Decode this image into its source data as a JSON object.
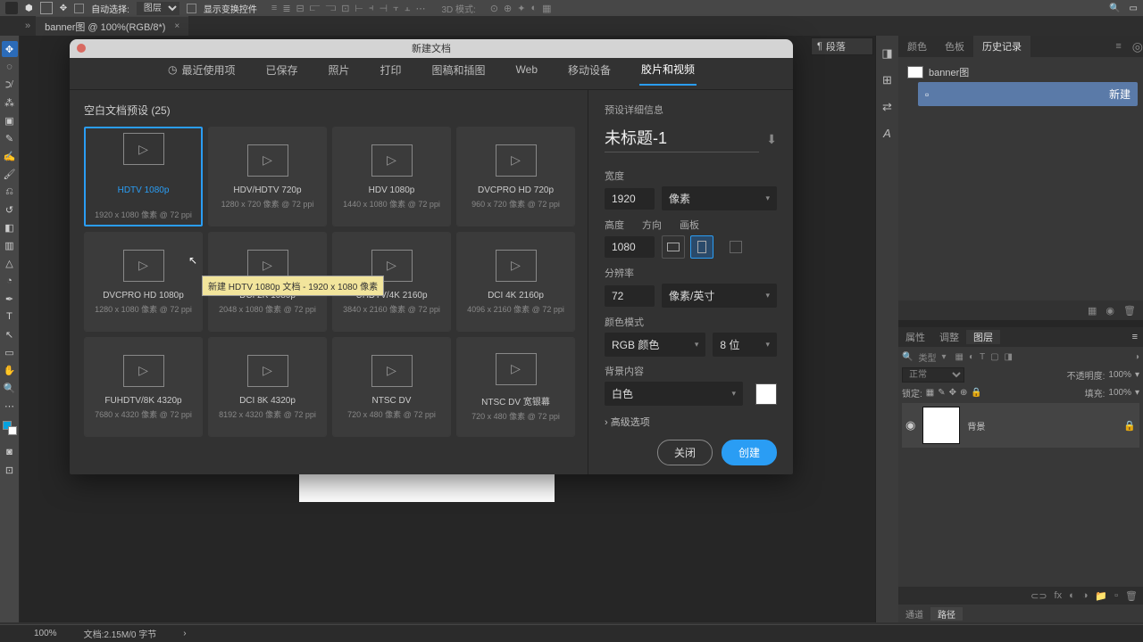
{
  "topbar": {
    "autoSelect": "自动选择:",
    "layerSel": "图层",
    "showTransform": "显示变换控件",
    "mode3d": "3D 模式:"
  },
  "docTab": {
    "title": "banner图 @ 100%(RGB/8*)"
  },
  "paragraph": {
    "label": "段落"
  },
  "historyPanel": {
    "tabs": [
      "颜色",
      "色板",
      "历史记录"
    ],
    "doc": "banner图",
    "step": "新建"
  },
  "layersPanel": {
    "headTabs": [
      "属性",
      "调整",
      "图层"
    ],
    "kind": "类型",
    "blend": "正常",
    "opacityLbl": "不透明度:",
    "opacity": "100%",
    "lockLbl": "锁定:",
    "fillLbl": "填充:",
    "fill": "100%",
    "layerName": "背景",
    "footTabs": [
      "通道",
      "路径"
    ]
  },
  "statusbar": {
    "zoom": "100%",
    "doc": "文档:2.15M/0 字节"
  },
  "dialog": {
    "title": "新建文档",
    "tabs": [
      "最近使用项",
      "已保存",
      "照片",
      "打印",
      "图稿和插图",
      "Web",
      "移动设备",
      "胶片和视频"
    ],
    "heading": "空白文档预设 (25)",
    "presets": [
      {
        "name": "HDTV 1080p",
        "desc": "1920 x 1080 像素 @ 72 ppi"
      },
      {
        "name": "HDV/HDTV 720p",
        "desc": "1280 x 720 像素 @ 72 ppi"
      },
      {
        "name": "HDV 1080p",
        "desc": "1440 x 1080 像素 @ 72 ppi"
      },
      {
        "name": "DVCPRO HD 720p",
        "desc": "960 x 720 像素 @ 72 ppi"
      },
      {
        "name": "DVCPRO HD 1080p",
        "desc": "1280 x 1080 像素 @ 72 ppi"
      },
      {
        "name": "DCI 2K 1080p",
        "desc": "2048 x 1080 像素 @ 72 ppi"
      },
      {
        "name": "UHDTV/4K 2160p",
        "desc": "3840 x 2160 像素 @ 72 ppi"
      },
      {
        "name": "DCI 4K 2160p",
        "desc": "4096 x 2160 像素 @ 72 ppi"
      },
      {
        "name": "FUHDTV/8K 4320p",
        "desc": "7680 x 4320 像素 @ 72 ppi"
      },
      {
        "name": "DCI 8K 4320p",
        "desc": "8192 x 4320 像素 @ 72 ppi"
      },
      {
        "name": "NTSC DV",
        "desc": "720 x 480 像素 @ 72 ppi"
      },
      {
        "name": "NTSC DV 宽银幕",
        "desc": "720 x 480 像素 @ 72 ppi"
      }
    ],
    "tooltip": "新建 HDTV 1080p 文档 - 1920 x 1080 像素",
    "details": {
      "heading": "预设详细信息",
      "docTitle": "未标题-1",
      "widthLbl": "宽度",
      "width": "1920",
      "widthUnit": "像素",
      "heightLbl": "高度",
      "height": "1080",
      "orientLbl": "方向",
      "artboardLbl": "画板",
      "resLbl": "分辨率",
      "res": "72",
      "resUnit": "像素/英寸",
      "colorLbl": "颜色模式",
      "colorMode": "RGB 颜色",
      "colorDepth": "8 位",
      "bgLbl": "背景内容",
      "bg": "白色",
      "advanced": "高级选项",
      "close": "关闭",
      "create": "创建"
    }
  }
}
